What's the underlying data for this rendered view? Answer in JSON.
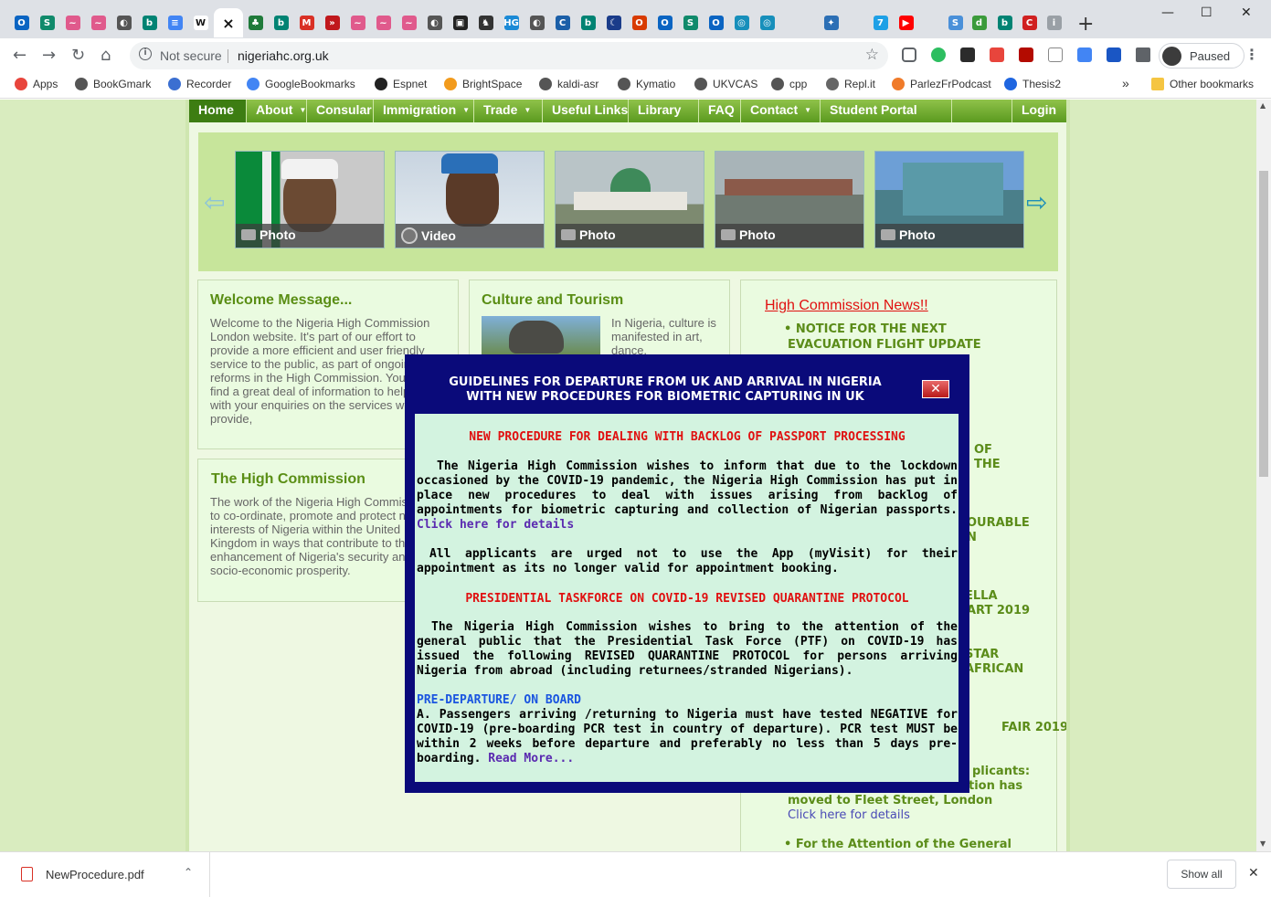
{
  "browser": {
    "tabs": [
      {
        "icon": "outlook-icon",
        "color": "#0a64c2",
        "glyph": "O"
      },
      {
        "icon": "sway-icon",
        "color": "#108a6b",
        "glyph": "S"
      },
      {
        "icon": "waveform-icon",
        "color": "#e05a8c",
        "glyph": "~"
      },
      {
        "icon": "waveform-icon",
        "color": "#e05a8c",
        "glyph": "~"
      },
      {
        "icon": "globe-icon",
        "color": "#555555",
        "glyph": "◐"
      },
      {
        "icon": "bing-icon",
        "color": "#008373",
        "glyph": "b"
      },
      {
        "icon": "docs-icon",
        "color": "#4285f4",
        "glyph": "≡"
      },
      {
        "icon": "wikipedia-icon",
        "color": "#ffffff",
        "glyph": "W"
      },
      {
        "icon": "close-icon",
        "color": "#ffffff",
        "glyph": "×",
        "active": true
      },
      {
        "icon": "coat-of-arms-icon",
        "color": "#1f7a3a",
        "glyph": "♣"
      },
      {
        "icon": "bing-icon",
        "color": "#008373",
        "glyph": "b"
      },
      {
        "icon": "gmail-icon",
        "color": "#d93025",
        "glyph": "M"
      },
      {
        "icon": "arrow-icon",
        "color": "#c0181c",
        "glyph": "»"
      },
      {
        "icon": "waveform-icon",
        "color": "#e05a8c",
        "glyph": "~"
      },
      {
        "icon": "waveform-icon",
        "color": "#e05a8c",
        "glyph": "~"
      },
      {
        "icon": "waveform-icon",
        "color": "#e05a8c",
        "glyph": "~"
      },
      {
        "icon": "globe-icon",
        "color": "#555555",
        "glyph": "◐"
      },
      {
        "icon": "news-icon",
        "color": "#222222",
        "glyph": "▣"
      },
      {
        "icon": "horse-icon",
        "color": "#333333",
        "glyph": "♞"
      },
      {
        "icon": "hg-icon",
        "color": "#1b8ad6",
        "glyph": "HG"
      },
      {
        "icon": "globe-icon",
        "color": "#555555",
        "glyph": "◐"
      },
      {
        "icon": "cdc-icon",
        "color": "#1b5fa8",
        "glyph": "C"
      },
      {
        "icon": "bing-icon",
        "color": "#008373",
        "glyph": "b"
      },
      {
        "icon": "moon-icon",
        "color": "#1a3c8a",
        "glyph": "☾"
      },
      {
        "icon": "office-icon",
        "color": "#d83b01",
        "glyph": "O"
      },
      {
        "icon": "outlook-icon",
        "color": "#0a64c2",
        "glyph": "O"
      },
      {
        "icon": "sway-icon",
        "color": "#108a6b",
        "glyph": "S"
      },
      {
        "icon": "outlook-icon",
        "color": "#0a64c2",
        "glyph": "O"
      },
      {
        "icon": "target-icon",
        "color": "#178fbb",
        "glyph": "◎"
      },
      {
        "icon": "target-icon",
        "color": "#178fbb",
        "glyph": "◎"
      },
      {
        "icon": "blank-icon",
        "color": "#dee1e6",
        "glyph": ""
      },
      {
        "icon": "compass-icon",
        "color": "#2c6fb5",
        "glyph": "✦"
      },
      {
        "icon": "blank-icon",
        "color": "#dee1e6",
        "glyph": ""
      },
      {
        "icon": "flash-icon",
        "color": "#1ea0e6",
        "glyph": "7"
      },
      {
        "icon": "youtube-icon",
        "color": "#ff0000",
        "glyph": "▶"
      },
      {
        "icon": "blank-icon",
        "color": "#dee1e6",
        "glyph": ""
      },
      {
        "icon": "s-circle-icon",
        "color": "#4a90d9",
        "glyph": "S"
      },
      {
        "icon": "dsd-icon",
        "color": "#3b9b3b",
        "glyph": "d"
      },
      {
        "icon": "bing-icon",
        "color": "#008373",
        "glyph": "b"
      },
      {
        "icon": "c-icon",
        "color": "#d02020",
        "glyph": "C"
      },
      {
        "icon": "info-icon",
        "color": "#9aa0a6",
        "glyph": "i"
      }
    ],
    "new_tab": "+",
    "window_controls": {
      "minimize": "—",
      "maximize": "☐",
      "close": "✕"
    },
    "address": {
      "security_label": "Not secure",
      "url": "nigeriahc.org.uk"
    },
    "profile_label": "Paused",
    "bookmarks": [
      {
        "label": "Apps",
        "icon": "apps-grid-icon",
        "color": "#e8453c"
      },
      {
        "label": "BookGmark",
        "icon": "globe-icon",
        "color": "#555555"
      },
      {
        "label": "Recorder",
        "icon": "recorder-icon",
        "color": "#3b6fd1"
      },
      {
        "label": "GoogleBookmarks",
        "icon": "google-icon",
        "color": "#4285f4"
      },
      {
        "label": "Espnet",
        "icon": "github-icon",
        "color": "#222222"
      },
      {
        "label": "BrightSpace",
        "icon": "brightspace-icon",
        "color": "#f29b1d"
      },
      {
        "label": "kaldi-asr",
        "icon": "globe-icon",
        "color": "#555555"
      },
      {
        "label": "Kymatio",
        "icon": "globe-icon",
        "color": "#555555"
      },
      {
        "label": "UKVCAS",
        "icon": "globe-icon",
        "color": "#555555"
      },
      {
        "label": "cpp",
        "icon": "globe-icon",
        "color": "#555555"
      },
      {
        "label": "Repl.it",
        "icon": "replit-icon",
        "color": "#666666"
      },
      {
        "label": "ParlezFrPodcast",
        "icon": "podcast-icon",
        "color": "#f07b2a"
      },
      {
        "label": "Thesis2",
        "icon": "dropbox-icon",
        "color": "#1f66e0"
      }
    ],
    "bookmarks_overflow": "»",
    "other_bookmarks": "Other bookmarks"
  },
  "site": {
    "nav": [
      {
        "label": "Home",
        "dropdown": false
      },
      {
        "label": "About",
        "dropdown": true
      },
      {
        "label": "Consular",
        "dropdown": false
      },
      {
        "label": "Immigration",
        "dropdown": true
      },
      {
        "label": "Trade",
        "dropdown": true
      },
      {
        "label": "Useful Links",
        "dropdown": false
      },
      {
        "label": "Library",
        "dropdown": false
      },
      {
        "label": "FAQ",
        "dropdown": false
      },
      {
        "label": "Contact",
        "dropdown": true
      },
      {
        "label": "Student Portal",
        "dropdown": false
      },
      {
        "label": "Login",
        "dropdown": false
      }
    ],
    "slider": {
      "prev_arrow": "⇦",
      "next_arrow": "⇨",
      "items": [
        {
          "caption": "Photo",
          "kind": "photo"
        },
        {
          "caption": "Video",
          "kind": "video"
        },
        {
          "caption": "Photo",
          "kind": "photo"
        },
        {
          "caption": "Photo",
          "kind": "photo"
        },
        {
          "caption": "Photo",
          "kind": "photo"
        }
      ]
    },
    "welcome": {
      "title": "Welcome Message...",
      "text": "Welcome to the Nigeria High Commission London website. It's part of our effort to provide a more efficient and user friendly service to the public, as part of ongoing reforms in the High Commission. You will find a great deal of information to help you with your enquiries on the services we provide,"
    },
    "culture": {
      "title": "Culture and Tourism",
      "text": "In Nigeria, culture is manifested in art, dance,"
    },
    "high_commission": {
      "title": "The High Commission",
      "text": "The work of the Nigeria High Commission is to co-ordinate, promote and protect national interests of Nigeria within the United Kingdom in ways that contribute to the enhancement of Nigeria's security and socio-economic prosperity."
    },
    "news": {
      "title": "High Commission News!!",
      "items": [
        "• NOTICE FOR THE NEXT",
        "EVACUATION FLIGHT UPDATE",
        "OF",
        "THE",
        "OURABLE",
        "N",
        "ELLA",
        "ART 2019",
        "STAR",
        "AFRICAN",
        "FAIR 2019",
        "plicants:",
        "tion has",
        "moved to Fleet Street, London",
        "• For the Attention of the General"
      ],
      "link": "Click here for details"
    }
  },
  "modal": {
    "title_line1": "GUIDELINES FOR DEPARTURE FROM UK AND ARRIVAL IN NIGERIA",
    "title_line2": "WITH NEW PROCEDURES FOR BIOMETRIC CAPTURING IN UK",
    "close": "✕",
    "heading1": "NEW PROCEDURE FOR DEALING WITH BACKLOG OF PASSPORT PROCESSING",
    "para1": "The Nigeria High Commission wishes to inform that due to the lockdown occasioned by the COVID-19 pandemic, the Nigeria High Commission has put in place new procedures to deal with issues arising from backlog of appointments for biometric capturing and collection of Nigerian passports.",
    "para1_link": "Click here for details",
    "para2": "All applicants are urged not to use the App (myVisit) for their appointment as its no longer valid for appointment booking.",
    "heading2": "PRESIDENTIAL TASKFORCE ON COVID-19 REVISED QUARANTINE PROTOCOL",
    "para3": "The Nigeria High Commission wishes to bring to the attention of the general public that the Presidential Task Force (PTF) on COVID-19 has issued the following REVISED QUARANTINE PROTOCOL for persons arriving Nigeria from abroad (including returnees/stranded Nigerians).",
    "heading3": "PRE-DEPARTURE/ ON BOARD",
    "para4": "A. Passengers arriving /returning to Nigeria must have tested NEGATIVE for COVID-19 (pre-boarding PCR test in country of departure). PCR test MUST be within 2 weeks before departure and preferably no less than 5 days pre-boarding.",
    "para4_link": "Read More..."
  },
  "downloads": {
    "file": "NewProcedure.pdf",
    "show_all": "Show all",
    "close": "✕"
  }
}
